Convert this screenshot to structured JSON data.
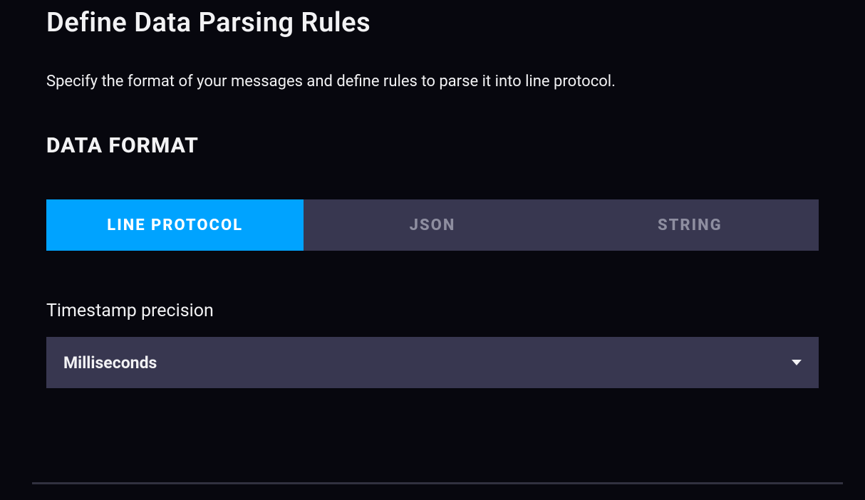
{
  "page": {
    "title": "Define Data Parsing Rules",
    "description": "Specify the format of your messages and define rules to parse it into line protocol."
  },
  "dataFormat": {
    "heading": "DATA FORMAT",
    "tabs": [
      {
        "label": "LINE PROTOCOL",
        "active": true
      },
      {
        "label": "JSON",
        "active": false
      },
      {
        "label": "STRING",
        "active": false
      }
    ]
  },
  "timestampPrecision": {
    "label": "Timestamp precision",
    "selected": "Milliseconds"
  }
}
